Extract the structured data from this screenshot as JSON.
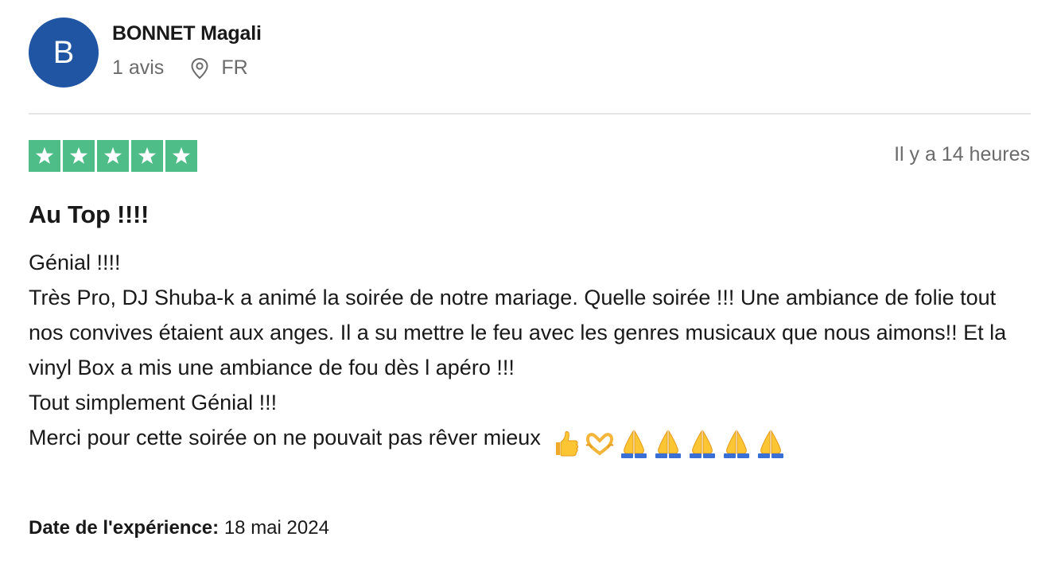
{
  "reviewer": {
    "avatar_initial": "B",
    "avatar_color": "#1f55a3",
    "name": "BONNET Magali",
    "review_count": "1 avis",
    "country": "FR"
  },
  "review": {
    "rating": 5,
    "rating_color": "#4fbd87",
    "time_ago": "Il y a 14 heures",
    "title": "Au Top !!!!",
    "body_lines": [
      "Génial !!!!",
      "Très Pro, DJ Shuba-k a animé la soirée de notre mariage. Quelle soirée !!! Une ambiance de folie tout nos convives étaient aux anges. Il a su mettre le feu avec les genres musicaux que nous aimons!! Et la vinyl Box a mis une ambiance de fou dès l apéro !!!",
      "Tout simplement Génial !!!",
      "Merci pour cette soirée on ne pouvait pas rêver mieux"
    ],
    "emojis": [
      "thumbs-up-icon",
      "heart-hands-icon",
      "praying-hands-icon",
      "praying-hands-icon",
      "praying-hands-icon",
      "praying-hands-icon",
      "praying-hands-icon"
    ],
    "experience_label": "Date de l'expérience:",
    "experience_date": "18 mai 2024"
  }
}
